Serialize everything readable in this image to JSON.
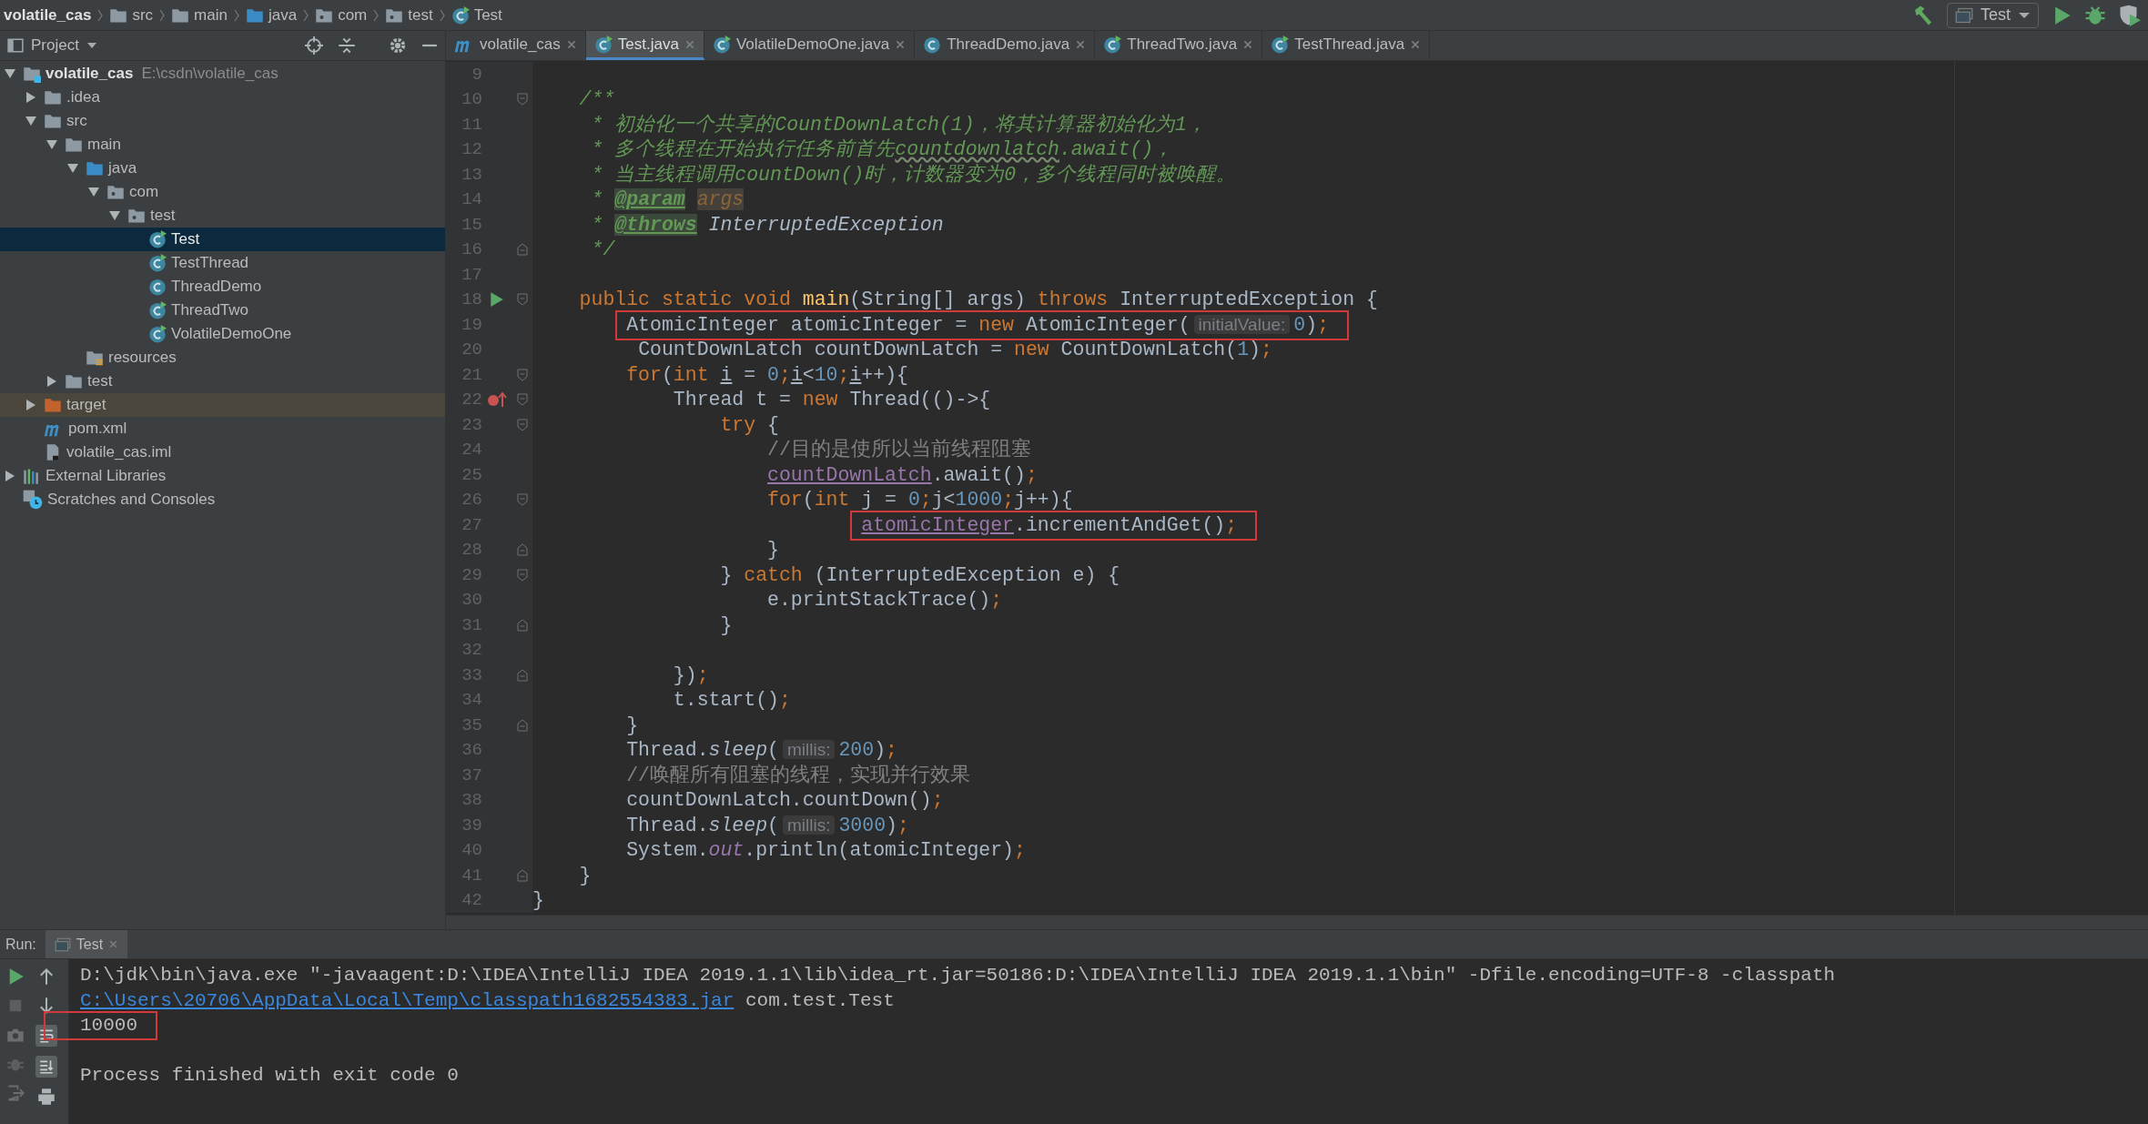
{
  "breadcrumbs": [
    {
      "label": "volatile_cas",
      "kind": "module"
    },
    {
      "label": "src",
      "kind": "folder"
    },
    {
      "label": "main",
      "kind": "folder"
    },
    {
      "label": "java",
      "kind": "source"
    },
    {
      "label": "com",
      "kind": "package"
    },
    {
      "label": "test",
      "kind": "package"
    },
    {
      "label": "Test",
      "kind": "class"
    }
  ],
  "run_configuration": {
    "label": "Test"
  },
  "project_panel": {
    "title": "Project",
    "tree": [
      {
        "label": "volatile_cas",
        "path": "E:\\csdn\\volatile_cas",
        "kind": "module",
        "expanded": true,
        "selected": false,
        "children": [
          {
            "label": ".idea",
            "kind": "folder",
            "expanded": false,
            "selected": false
          },
          {
            "label": "src",
            "kind": "folder",
            "expanded": true,
            "selected": false,
            "children": [
              {
                "label": "main",
                "kind": "folder",
                "expanded": true,
                "selected": false,
                "children": [
                  {
                    "label": "java",
                    "kind": "source",
                    "expanded": true,
                    "selected": false,
                    "children": [
                      {
                        "label": "com",
                        "kind": "package",
                        "expanded": true,
                        "selected": false,
                        "children": [
                          {
                            "label": "test",
                            "kind": "package",
                            "expanded": true,
                            "selected": false,
                            "children": [
                              {
                                "label": "Test",
                                "kind": "class-runnable",
                                "selected": true
                              },
                              {
                                "label": "TestThread",
                                "kind": "class-runnable",
                                "selected": false
                              },
                              {
                                "label": "ThreadDemo",
                                "kind": "class",
                                "selected": false
                              },
                              {
                                "label": "ThreadTwo",
                                "kind": "class-runnable",
                                "selected": false
                              },
                              {
                                "label": "VolatileDemoOne",
                                "kind": "class-runnable",
                                "selected": false
                              }
                            ]
                          }
                        ]
                      }
                    ]
                  },
                  {
                    "label": "resources",
                    "kind": "resources",
                    "selected": false
                  }
                ]
              },
              {
                "label": "test",
                "kind": "folder",
                "expanded": false,
                "selected": false
              }
            ]
          },
          {
            "label": "target",
            "kind": "excluded",
            "expanded": false,
            "selected": false
          },
          {
            "label": "pom.xml",
            "kind": "maven",
            "selected": false
          },
          {
            "label": "volatile_cas.iml",
            "kind": "iml",
            "selected": false
          }
        ]
      },
      {
        "label": "External Libraries",
        "kind": "libraries",
        "expanded": false,
        "selected": false
      },
      {
        "label": "Scratches and Consoles",
        "kind": "scratches",
        "selected": false
      }
    ]
  },
  "editor_tabs": [
    {
      "label": "volatile_cas",
      "kind": "maven",
      "selected": false
    },
    {
      "label": "Test.java",
      "kind": "class-runnable",
      "selected": true
    },
    {
      "label": "VolatileDemoOne.java",
      "kind": "class-runnable",
      "selected": false
    },
    {
      "label": "ThreadDemo.java",
      "kind": "class",
      "selected": false
    },
    {
      "label": "ThreadTwo.java",
      "kind": "class-runnable",
      "selected": false
    },
    {
      "label": "TestThread.java",
      "kind": "class-runnable",
      "selected": false
    }
  ],
  "editor": {
    "lines": [
      {
        "number": "9"
      },
      {
        "number": "10",
        "fold_start": true,
        "tokens": [
          {
            "kind": "doc",
            "text": "    /**"
          }
        ]
      },
      {
        "number": "11",
        "tokens": [
          {
            "kind": "doc",
            "text": "     * 初始化一个共享的CountDownLatch(1)，将其计算器初始化为1，"
          }
        ]
      },
      {
        "number": "12",
        "tokens": [
          {
            "kind": "doc",
            "text": "     * 多个线程在开始执行任务前首先"
          },
          {
            "kind": "doc-typo",
            "text": "countdownlatch"
          },
          {
            "kind": "doc",
            "text": ".await()，"
          }
        ]
      },
      {
        "number": "13",
        "tokens": [
          {
            "kind": "doc",
            "text": "     * 当主线程调用countDown()时，计数器变为0，多个线程同时被唤醒。"
          }
        ]
      },
      {
        "number": "14",
        "tokens": [
          {
            "kind": "doc",
            "text": "     * "
          },
          {
            "kind": "doc-tag",
            "text": "@param"
          },
          {
            "kind": "doc-param",
            "text": " args"
          }
        ]
      },
      {
        "number": "15",
        "tokens": [
          {
            "kind": "doc",
            "text": "     * "
          },
          {
            "kind": "doc-tag",
            "text": "@throws"
          },
          {
            "kind": "doc-ref",
            "text": " InterruptedException"
          }
        ]
      },
      {
        "number": "16",
        "fold_end": true,
        "tokens": [
          {
            "kind": "doc",
            "text": "     */"
          }
        ]
      },
      {
        "number": "17"
      },
      {
        "number": "18",
        "run_marker": true,
        "fold_start": true,
        "tokens": [
          {
            "kind": "keyword",
            "text": "    public static void "
          },
          {
            "kind": "method",
            "text": "main"
          },
          {
            "kind": "plain",
            "text": "(String[] args) "
          },
          {
            "kind": "keyword",
            "text": "throws "
          },
          {
            "kind": "plain",
            "text": "InterruptedException {"
          }
        ]
      },
      {
        "number": "19",
        "boxed": true,
        "tokens": [
          {
            "kind": "plain",
            "text": "        AtomicInteger atomicInteger = "
          },
          {
            "kind": "keyword",
            "text": "new "
          },
          {
            "kind": "plain",
            "text": "AtomicInteger("
          },
          {
            "kind": "hint",
            "text": "initialValue:"
          },
          {
            "kind": "number",
            "text": "0"
          },
          {
            "kind": "plain",
            "text": ")"
          },
          {
            "kind": "keyword",
            "text": ";"
          }
        ]
      },
      {
        "number": "20",
        "tokens": [
          {
            "kind": "plain",
            "text": "         CountDownLatch countDownLatch = "
          },
          {
            "kind": "keyword",
            "text": "new "
          },
          {
            "kind": "plain",
            "text": "CountDownLatch("
          },
          {
            "kind": "number",
            "text": "1"
          },
          {
            "kind": "plain",
            "text": ")"
          },
          {
            "kind": "keyword",
            "text": ";"
          }
        ]
      },
      {
        "number": "21",
        "fold_start": true,
        "tokens": [
          {
            "kind": "keyword",
            "text": "        for"
          },
          {
            "kind": "plain",
            "text": "("
          },
          {
            "kind": "keyword",
            "text": "int "
          },
          {
            "kind": "reassigned",
            "text": "i"
          },
          {
            "kind": "plain",
            "text": " = "
          },
          {
            "kind": "number",
            "text": "0"
          },
          {
            "kind": "keyword",
            "text": ";"
          },
          {
            "kind": "reassigned",
            "text": "i"
          },
          {
            "kind": "plain",
            "text": "<"
          },
          {
            "kind": "number",
            "text": "10"
          },
          {
            "kind": "keyword",
            "text": ";"
          },
          {
            "kind": "reassigned",
            "text": "i"
          },
          {
            "kind": "plain",
            "text": "++){"
          }
        ]
      },
      {
        "number": "22",
        "lambda_marker": true,
        "fold_start": true,
        "tokens": [
          {
            "kind": "plain",
            "text": "            Thread t = "
          },
          {
            "kind": "keyword",
            "text": "new "
          },
          {
            "kind": "plain",
            "text": "Thread(()->{"
          }
        ]
      },
      {
        "number": "23",
        "fold_start": true,
        "tokens": [
          {
            "kind": "keyword",
            "text": "                try "
          },
          {
            "kind": "plain",
            "text": "{"
          }
        ]
      },
      {
        "number": "24",
        "tokens": [
          {
            "kind": "comment",
            "text": "                    //目的是使所以当前线程阻塞"
          }
        ]
      },
      {
        "number": "25",
        "tokens": [
          {
            "kind": "field",
            "text": "                    countDownLatch"
          },
          {
            "kind": "plain",
            "text": ".await()"
          },
          {
            "kind": "keyword",
            "text": ";"
          }
        ]
      },
      {
        "number": "26",
        "fold_start": true,
        "tokens": [
          {
            "kind": "keyword",
            "text": "                    for"
          },
          {
            "kind": "plain",
            "text": "("
          },
          {
            "kind": "keyword",
            "text": "int "
          },
          {
            "kind": "plain",
            "text": "j = "
          },
          {
            "kind": "number",
            "text": "0"
          },
          {
            "kind": "keyword",
            "text": ";"
          },
          {
            "kind": "plain",
            "text": "j<"
          },
          {
            "kind": "number",
            "text": "1000"
          },
          {
            "kind": "keyword",
            "text": ";"
          },
          {
            "kind": "plain",
            "text": "j++){"
          }
        ]
      },
      {
        "number": "27",
        "boxed": true,
        "tokens": [
          {
            "kind": "field",
            "text": "                            atomicInteger"
          },
          {
            "kind": "plain",
            "text": ".incrementAndGet()"
          },
          {
            "kind": "keyword",
            "text": ";"
          }
        ]
      },
      {
        "number": "28",
        "fold_end": true,
        "tokens": [
          {
            "kind": "plain",
            "text": "                    }"
          }
        ]
      },
      {
        "number": "29",
        "fold_start": true,
        "tokens": [
          {
            "kind": "plain",
            "text": "                } "
          },
          {
            "kind": "keyword",
            "text": "catch "
          },
          {
            "kind": "plain",
            "text": "(InterruptedException e) {"
          }
        ]
      },
      {
        "number": "30",
        "tokens": [
          {
            "kind": "plain",
            "text": "                    e.printStackTrace()"
          },
          {
            "kind": "keyword",
            "text": ";"
          }
        ]
      },
      {
        "number": "31",
        "fold_end": true,
        "tokens": [
          {
            "kind": "plain",
            "text": "                }"
          }
        ]
      },
      {
        "number": "32"
      },
      {
        "number": "33",
        "fold_end": true,
        "tokens": [
          {
            "kind": "plain",
            "text": "            })"
          },
          {
            "kind": "keyword",
            "text": ";"
          }
        ]
      },
      {
        "number": "34",
        "tokens": [
          {
            "kind": "plain",
            "text": "            t.start()"
          },
          {
            "kind": "keyword",
            "text": ";"
          }
        ]
      },
      {
        "number": "35",
        "fold_end": true,
        "tokens": [
          {
            "kind": "plain",
            "text": "        }"
          }
        ]
      },
      {
        "number": "36",
        "tokens": [
          {
            "kind": "plain",
            "text": "        Thread."
          },
          {
            "kind": "static-method",
            "text": "sleep"
          },
          {
            "kind": "plain",
            "text": "("
          },
          {
            "kind": "hint",
            "text": "millis:"
          },
          {
            "kind": "number",
            "text": "200"
          },
          {
            "kind": "plain",
            "text": ")"
          },
          {
            "kind": "keyword",
            "text": ";"
          }
        ]
      },
      {
        "number": "37",
        "tokens": [
          {
            "kind": "comment",
            "text": "        //唤醒所有阻塞的线程，实现并行效果"
          }
        ]
      },
      {
        "number": "38",
        "tokens": [
          {
            "kind": "plain",
            "text": "        countDownLatch.countDown()"
          },
          {
            "kind": "keyword",
            "text": ";"
          }
        ]
      },
      {
        "number": "39",
        "tokens": [
          {
            "kind": "plain",
            "text": "        Thread."
          },
          {
            "kind": "static-method",
            "text": "sleep"
          },
          {
            "kind": "plain",
            "text": "("
          },
          {
            "kind": "hint",
            "text": "millis:"
          },
          {
            "kind": "number",
            "text": "3000"
          },
          {
            "kind": "plain",
            "text": ")"
          },
          {
            "kind": "keyword",
            "text": ";"
          }
        ]
      },
      {
        "number": "40",
        "tokens": [
          {
            "kind": "plain",
            "text": "        System."
          },
          {
            "kind": "static-field",
            "text": "out"
          },
          {
            "kind": "plain",
            "text": ".println(atomicInteger)"
          },
          {
            "kind": "keyword",
            "text": ";"
          }
        ]
      },
      {
        "number": "41",
        "fold_end": true,
        "tokens": [
          {
            "kind": "plain",
            "text": "    }"
          }
        ]
      },
      {
        "number": "42",
        "tokens": [
          {
            "kind": "plain",
            "text": "}"
          }
        ]
      }
    ]
  },
  "run_panel": {
    "label": "Run:",
    "tabs": [
      {
        "label": "Test",
        "selected": true
      }
    ],
    "console": [
      {
        "tokens": [
          {
            "kind": "plain",
            "text": "D:\\jdk\\bin\\java.exe \"-javaagent:D:\\IDEA\\IntelliJ IDEA 2019.1.1\\lib\\idea_rt.jar=50186:D:\\IDEA\\IntelliJ IDEA 2019.1.1\\bin\" -Dfile.encoding=UTF-8 -classpath"
          }
        ]
      },
      {
        "tokens": [
          {
            "kind": "link",
            "text": "C:\\Users\\20706\\AppData\\Local\\Temp\\classpath1682554383.jar"
          },
          {
            "kind": "plain",
            "text": " com.test.Test"
          }
        ]
      },
      {
        "boxed": true,
        "tokens": [
          {
            "kind": "plain",
            "text": "10000"
          }
        ]
      },
      {
        "tokens": [
          {
            "kind": "plain",
            "text": "Process finished with exit code 0"
          }
        ]
      }
    ]
  }
}
